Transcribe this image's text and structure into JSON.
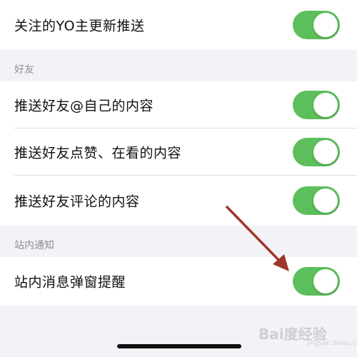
{
  "rows": {
    "follow_update": {
      "label": "关注的YO主更新推送",
      "enabled": true
    },
    "friend_at": {
      "label": "推送好友@自己的内容",
      "enabled": true
    },
    "friend_like": {
      "label": "推送好友点赞、在看的内容",
      "enabled": true
    },
    "friend_comment": {
      "label": "推送好友评论的内容",
      "enabled": true
    },
    "site_popup": {
      "label": "站内消息弹窗提醒",
      "enabled": true
    }
  },
  "sections": {
    "friends": "好友",
    "site_notice": "站内通知"
  },
  "watermark": {
    "text": "Bai度经验",
    "sub": "jingyan.baidu.com"
  },
  "colors": {
    "toggle_on": "#5cbf5b",
    "background": "#f2f2f7",
    "arrow": "#a2352a"
  },
  "icons": {
    "annotation": "arrow-annotation-icon",
    "watermark": "baidu-jingyan-logo"
  }
}
